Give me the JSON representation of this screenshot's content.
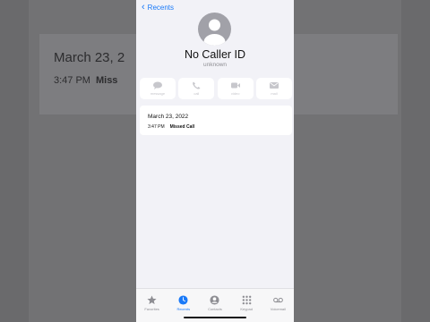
{
  "background": {
    "date": "March 23, 2",
    "time": "3:47 PM",
    "missed": "Miss"
  },
  "nav": {
    "back_label": "Recents"
  },
  "caller": {
    "name": "No Caller ID",
    "subtitle": "unknown"
  },
  "actions": [
    {
      "label": "message",
      "icon": "message-icon"
    },
    {
      "label": "call",
      "icon": "phone-icon"
    },
    {
      "label": "video",
      "icon": "video-icon"
    },
    {
      "label": "mail",
      "icon": "mail-icon"
    }
  ],
  "call_log": {
    "date": "March 23, 2022",
    "time": "3:47 PM",
    "status": "Missed Call"
  },
  "tabs": [
    {
      "label": "Favorites",
      "icon": "star-icon",
      "active": false
    },
    {
      "label": "Recents",
      "icon": "clock-icon",
      "active": true
    },
    {
      "label": "Contacts",
      "icon": "person-icon",
      "active": false
    },
    {
      "label": "Keypad",
      "icon": "keypad-icon",
      "active": false
    },
    {
      "label": "Voicemail",
      "icon": "voicemail-icon",
      "active": false
    }
  ],
  "colors": {
    "accent": "#1a7af8",
    "screen_bg": "#f2f2f7",
    "inactive_gray": "#8e8e93"
  }
}
